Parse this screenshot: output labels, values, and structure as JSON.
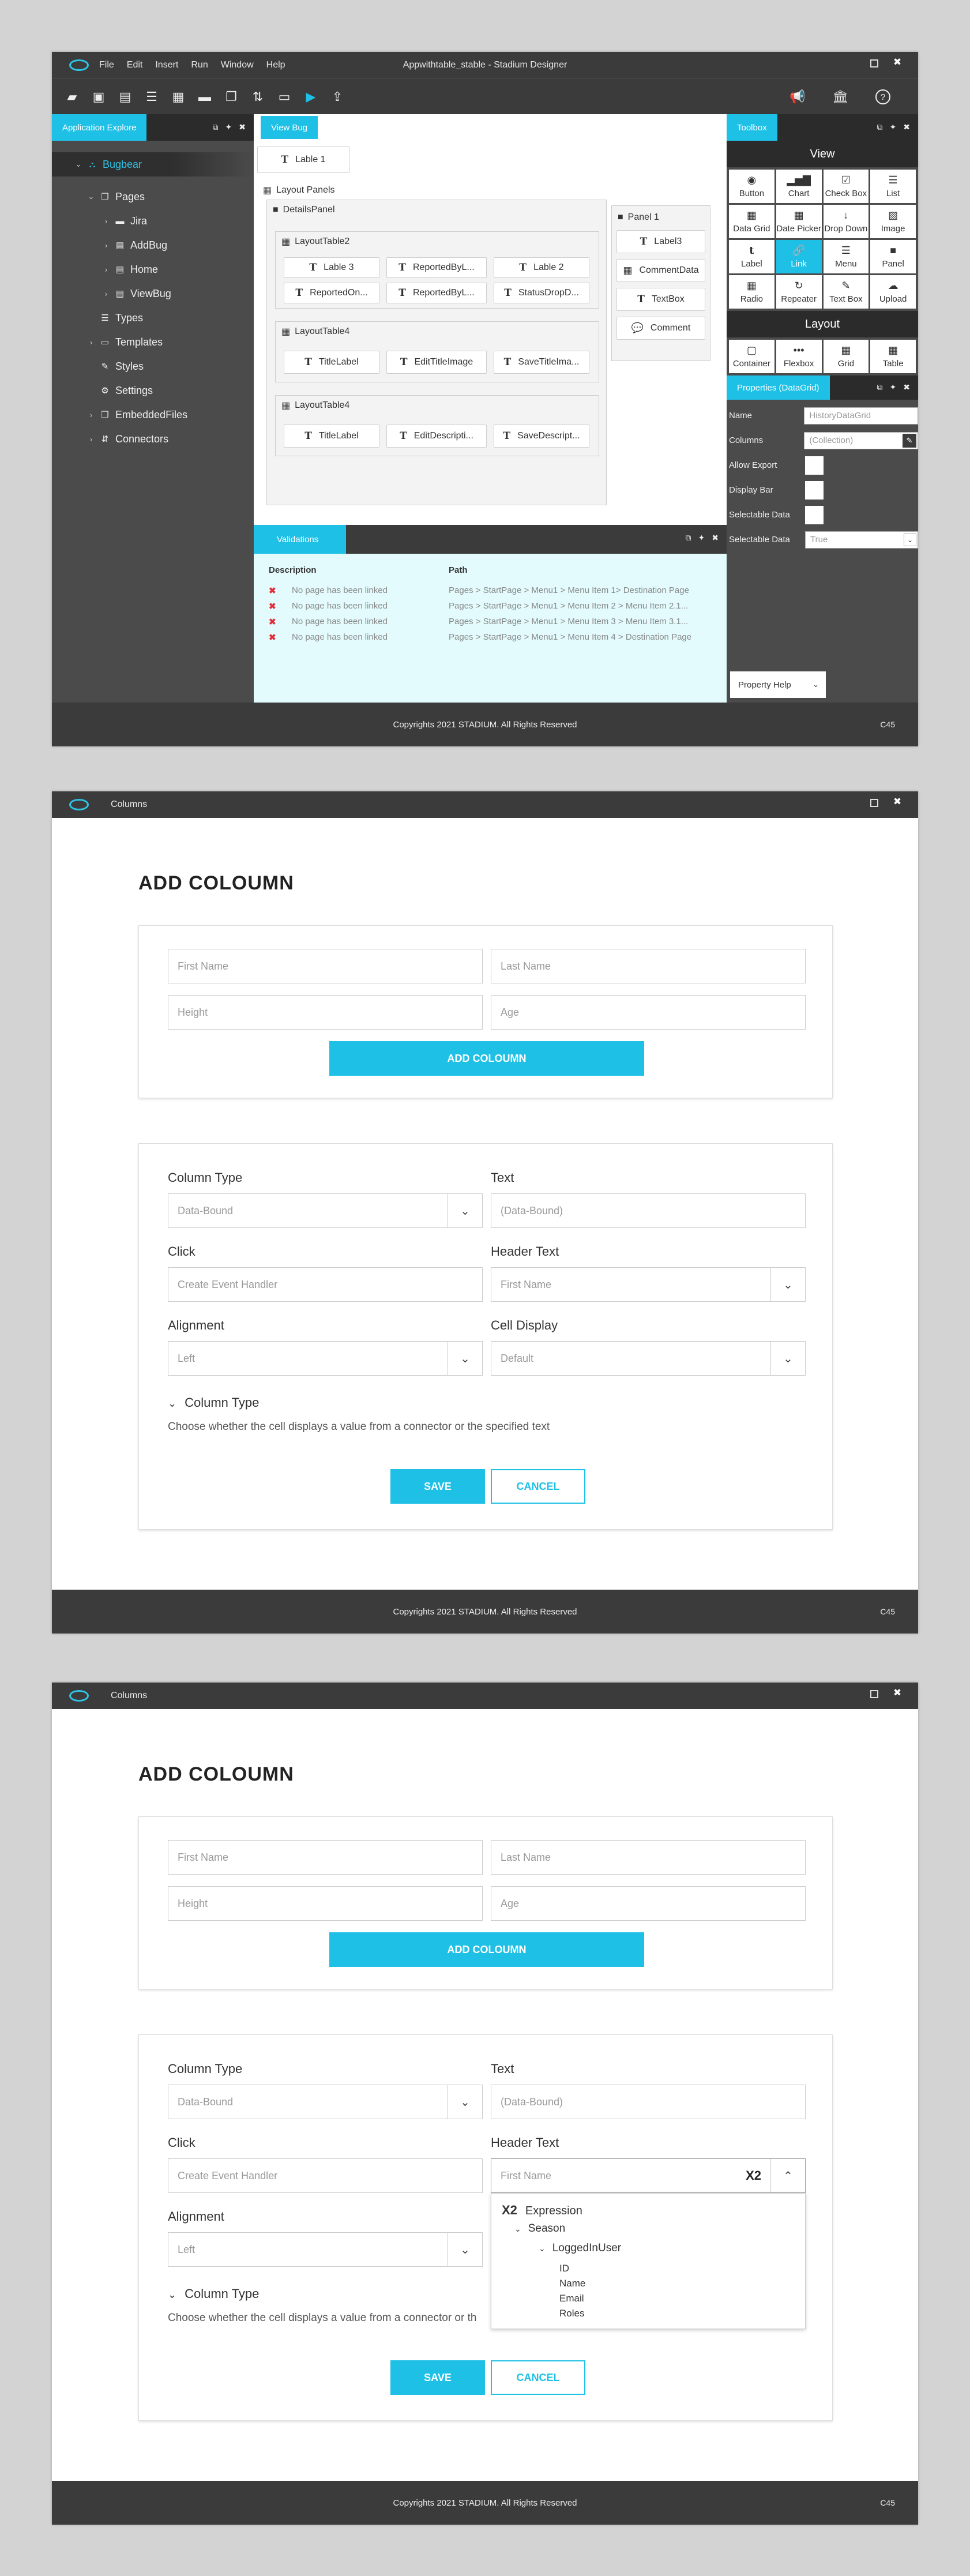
{
  "w1": {
    "title": "Appwithtable_stable - Stadium Designer",
    "menu": [
      "File",
      "Edit",
      "Insert",
      "Run",
      "Window",
      "Help"
    ],
    "left_tab": "Application Explore",
    "tree": {
      "root": "Bugbear",
      "pages": "Pages",
      "jira": "Jira",
      "addbug": "AddBug",
      "home": "Home",
      "viewbug": "ViewBug",
      "types": "Types",
      "templates": "Templates",
      "styles": "Styles",
      "settings": "Settings",
      "embedded": "EmbeddedFiles",
      "connectors": "Connectors"
    },
    "center_tab": "View Bug",
    "lable1": "Lable 1",
    "layout_panels": "Layout Panels",
    "details_panel": "DetailsPanel",
    "lt2": {
      "name": "LayoutTable2",
      "cells": [
        "Lable 3",
        "ReportedByL...",
        "Lable 2",
        "ReportedOn...",
        "ReportedByL...",
        "StatusDropD..."
      ]
    },
    "lt4a": {
      "name": "LayoutTable4",
      "cells": [
        "TitleLabel",
        "EditTitleImage",
        "SaveTitleIma..."
      ]
    },
    "lt4b": {
      "name": "LayoutTable4",
      "cells": [
        "TitleLabel",
        "EditDescripti...",
        "SaveDescript..."
      ]
    },
    "panel1": {
      "name": "Panel 1",
      "items": [
        "Label3",
        "CommentData",
        "TextBox",
        "Comment"
      ]
    },
    "validations": {
      "tab": "Validations",
      "col_desc": "Description",
      "col_path": "Path",
      "rows": [
        {
          "d": "No page has been linked",
          "p": "Pages > StartPage > Menu1 > Menu Item 1> Destination Page"
        },
        {
          "d": "No page has been linked",
          "p": "Pages > StartPage > Menu1 > Menu Item 2 > Menu Item 2.1..."
        },
        {
          "d": "No page has been linked",
          "p": "Pages > StartPage > Menu1 > Menu Item 3 > Menu Item 3.1..."
        },
        {
          "d": "No page has been linked",
          "p": "Pages > StartPage > Menu1 > Menu Item 4 > Destination Page"
        }
      ]
    },
    "toolbox": {
      "tab": "Toolbox",
      "view": "View",
      "layout": "Layout",
      "view_items": [
        "Button",
        "Chart",
        "Check Box",
        "List",
        "Data Grid",
        "Date Picker",
        "Drop Down",
        "Image",
        "Label",
        "Link",
        "Menu",
        "Panel",
        "Radio",
        "Repeater",
        "Text Box",
        "Upload"
      ],
      "layout_items": [
        "Container",
        "Flexbox",
        "Grid",
        "Table"
      ]
    },
    "props": {
      "tab": "Properties (DataGrid)",
      "name_label": "Name",
      "name_value": "HistoryDataGrid",
      "columns_label": "Columns",
      "columns_value": "(Collection)",
      "allow_export": "Allow Export",
      "display_bar": "Display Bar",
      "selectable_data": "Selectable Data",
      "selectable_data2": "Selectable Data",
      "selectable_value": "True",
      "help": "Property Help"
    },
    "footer": "Copyrights 2021 STADIUM. All Rights Reserved",
    "version": "C45"
  },
  "w2": {
    "title": "Columns",
    "heading": "ADD COLOUMN",
    "ph": {
      "first": "First Name",
      "last": "Last Name",
      "height": "Height",
      "age": "Age"
    },
    "add_btn": "ADD COLOUMN",
    "labels": {
      "coltype": "Column Type",
      "text": "Text",
      "click": "Click",
      "header": "Header Text",
      "align": "Alignment",
      "cell": "Cell Display"
    },
    "values": {
      "coltype": "Data-Bound",
      "text": "(Data-Bound)",
      "click": "Create Event Handler",
      "header": "First Name",
      "align": "Left",
      "cell": "Default"
    },
    "section": "Column Type",
    "desc": "Choose whether the cell displays a value from a connector or the specified text",
    "save": "SAVE",
    "cancel": "CANCEL",
    "footer": "Copyrights 2021 STADIUM. All Rights Reserved",
    "version": "C45"
  },
  "w3": {
    "title": "Columns",
    "heading": "ADD COLOUMN",
    "ph": {
      "first": "First Name",
      "last": "Last Name",
      "height": "Height",
      "age": "Age"
    },
    "add_btn": "ADD COLOUMN",
    "labels": {
      "coltype": "Column Type",
      "text": "Text",
      "click": "Click",
      "header": "Header Text",
      "align": "Alignment"
    },
    "values": {
      "coltype": "Data-Bound",
      "text": "(Data-Bound)",
      "click": "Create Event Handler",
      "header": "First Name",
      "align": "Left"
    },
    "x2": "X2",
    "popup": {
      "x2": "X2",
      "expression": "Expression",
      "season": "Season",
      "logged": "LoggedInUser",
      "items": [
        "ID",
        "Name",
        "Email",
        "Roles"
      ]
    },
    "section": "Column Type",
    "desc": "Choose whether the cell displays a value from a connector or th",
    "save": "SAVE",
    "cancel": "CANCEL",
    "footer": "Copyrights 2021 STADIUM. All Rights Reserved",
    "version": "C45"
  }
}
